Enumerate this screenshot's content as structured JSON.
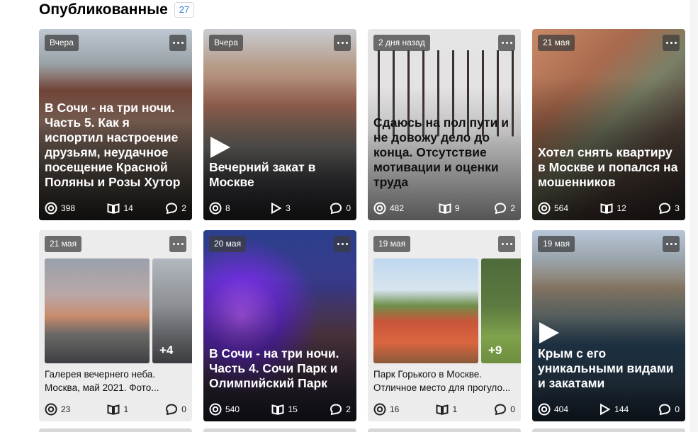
{
  "header": {
    "title": "Опубликованные",
    "count": "27"
  },
  "cards": [
    {
      "date": "Вчера",
      "title": "В Сочи - на три ночи. Часть 5. Как я испортил настроение друзьям, неудачное посещение Красной Поляны и Розы Хутор",
      "views": "398",
      "reads": "14",
      "comments": "2",
      "kind": "article"
    },
    {
      "date": "Вчера",
      "title": "Вечерний закат в Москве",
      "views": "8",
      "plays": "3",
      "comments": "0",
      "kind": "video"
    },
    {
      "date": "2 дня назад",
      "title": "Сдаюсь на пол пути и не довожу дело до конца. Отсутствие мотивации и оценки труда",
      "views": "482",
      "reads": "9",
      "comments": "2",
      "kind": "article"
    },
    {
      "date": "21 мая",
      "title": "Хотел снять квартиру в Москве и попался на мошенников",
      "views": "564",
      "reads": "12",
      "comments": "3",
      "kind": "article"
    },
    {
      "date": "21 мая",
      "desc_line1": "Галерея вечернего неба.",
      "desc_line2": "Москва, май 2021. Фото...",
      "more": "+4",
      "views": "23",
      "reads": "1",
      "comments": "0",
      "kind": "gallery"
    },
    {
      "date": "20 мая",
      "title": "В Сочи - на три ночи. Часть 4. Сочи Парк и Олимпийский Парк",
      "views": "540",
      "reads": "15",
      "comments": "2",
      "kind": "article"
    },
    {
      "date": "19 мая",
      "desc_line1": "Парк Горького в Москве.",
      "desc_line2": "Отличное место для прогуло...",
      "more": "+9",
      "views": "16",
      "reads": "1",
      "comments": "0",
      "kind": "gallery"
    },
    {
      "date": "19 мая",
      "title": "Крым с его уникальными видами и закатами",
      "views": "404",
      "plays": "144",
      "comments": "0",
      "kind": "video"
    }
  ]
}
